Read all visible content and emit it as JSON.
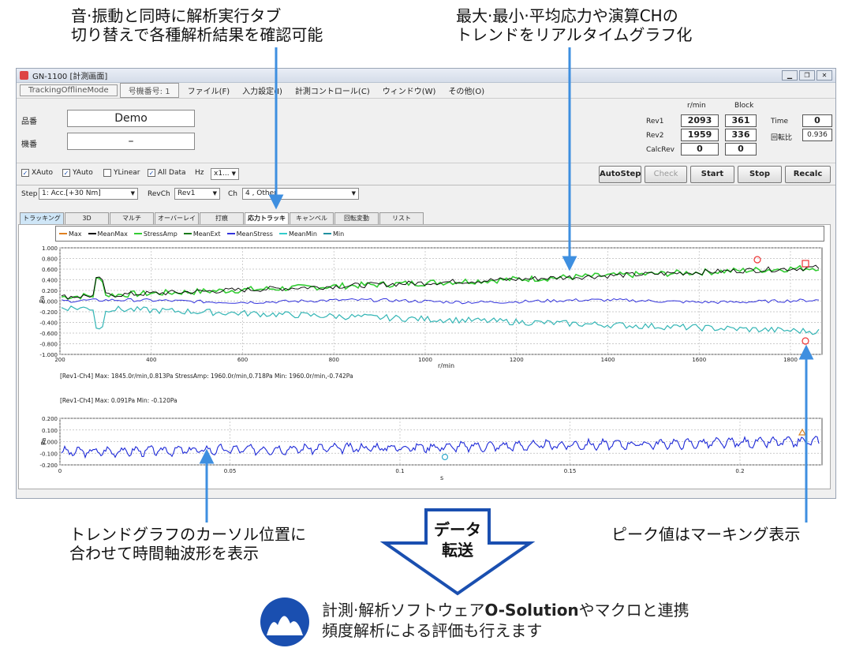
{
  "callouts": {
    "tab_switch": [
      "音·振動と同時に解析実行タブ",
      "切り替えで各種解析結果を確認可能"
    ],
    "trend": [
      "最大·最小·平均応力や演算CHの",
      "トレンドをリアルタイムグラフ化"
    ],
    "cursor": [
      "トレンドグラフのカーソル位置に",
      "合わせて時間軸波形を表示"
    ],
    "peak": "ピーク値はマーキング表示",
    "transfer": [
      "データ",
      "転送"
    ],
    "bottom_line1_pre": "計測·解析ソフトウェア",
    "bottom_line1_bold": "O-Solution",
    "bottom_line1_post": "やマクロと連携",
    "bottom_line2": "頻度解析による評価も行えます"
  },
  "window": {
    "title": "GN-1100 [計測画面]",
    "mode": "TrackingOfflineMode",
    "machine_no": "号機番号: 1",
    "menu": [
      "ファイル(F)",
      "入力設定(I)",
      "計測コントロール(C)",
      "ウィンドウ(W)",
      "その他(O)"
    ]
  },
  "product": {
    "label": "品番",
    "value": "Demo"
  },
  "serial": {
    "label": "機番",
    "value": "–"
  },
  "rev_panel": {
    "col_rpm": "r/min",
    "col_block": "Block",
    "rows": [
      {
        "label": "Rev1",
        "rpm": "2093",
        "block": "361"
      },
      {
        "label": "Rev2",
        "rpm": "1959",
        "block": "336"
      },
      {
        "label": "CalcRev",
        "rpm": "0",
        "block": "0"
      }
    ],
    "time_label": "Time",
    "time_value": "0",
    "ratio_label": "回転比",
    "ratio_value": "0.936"
  },
  "checkboxes": [
    {
      "label": "XAuto",
      "checked": true
    },
    {
      "label": "YAuto",
      "checked": true
    },
    {
      "label": "YLinear",
      "checked": false
    },
    {
      "label": "All Data",
      "checked": true
    }
  ],
  "hz_label": "Hz",
  "hz_value": "x1...",
  "buttons": {
    "autostep": "AutoStep",
    "check": "Check",
    "start": "Start",
    "stop": "Stop",
    "recalc": "Recalc"
  },
  "step": {
    "label": "Step",
    "value": "1: Acc.[+30 Nm]"
  },
  "revch": {
    "label": "RevCh",
    "value": "Rev1"
  },
  "ch": {
    "label": "Ch",
    "value": "4 , Other"
  },
  "tabs": [
    "トラッキング",
    "3D",
    "マルチ",
    "オーバーレイ",
    "打痕",
    "応力トラッキング",
    "キャンベル",
    "回転変動",
    "リスト"
  ],
  "legend": [
    {
      "name": "Max",
      "color": "#e08020"
    },
    {
      "name": "MeanMax",
      "color": "#000000"
    },
    {
      "name": "StressAmp",
      "color": "#33cc33"
    },
    {
      "name": "MeanExt",
      "color": "#1a7a1a"
    },
    {
      "name": "MeanStress",
      "color": "#3333dd"
    },
    {
      "name": "MeanMin",
      "color": "#33cccc"
    },
    {
      "name": "Min",
      "color": "#2090a0"
    }
  ],
  "trend_axis": {
    "yticks": [
      "1.000",
      "0.800",
      "0.600",
      "0.400",
      "0.200",
      "0.000",
      "-0.200",
      "-0.400",
      "-0.600",
      "-0.800",
      "-1.000"
    ],
    "xticks": [
      "200",
      "400",
      "600",
      "800",
      "1000",
      "1200",
      "1400",
      "1600",
      "1800"
    ],
    "ylabel": "Pa",
    "xlabel": "r/min"
  },
  "trend_info": "[Rev1-Ch4]  Max: 1845.0r/min,0.813Pa  StressAmp: 1960.0r/min,0.718Pa  Min: 1960.0r/min,-0.742Pa",
  "wave_info": "[Rev1-Ch4]  Max: 0.091Pa  Min: -0.120Pa",
  "wave_axis": {
    "yticks": [
      "0.200",
      "0.100",
      "0.000",
      "-0.100",
      "-0.200"
    ],
    "xticks": [
      "0",
      "0.05",
      "0.1",
      "0.15",
      "0.2"
    ],
    "ylabel": "Pa",
    "xlabel": "s"
  }
}
